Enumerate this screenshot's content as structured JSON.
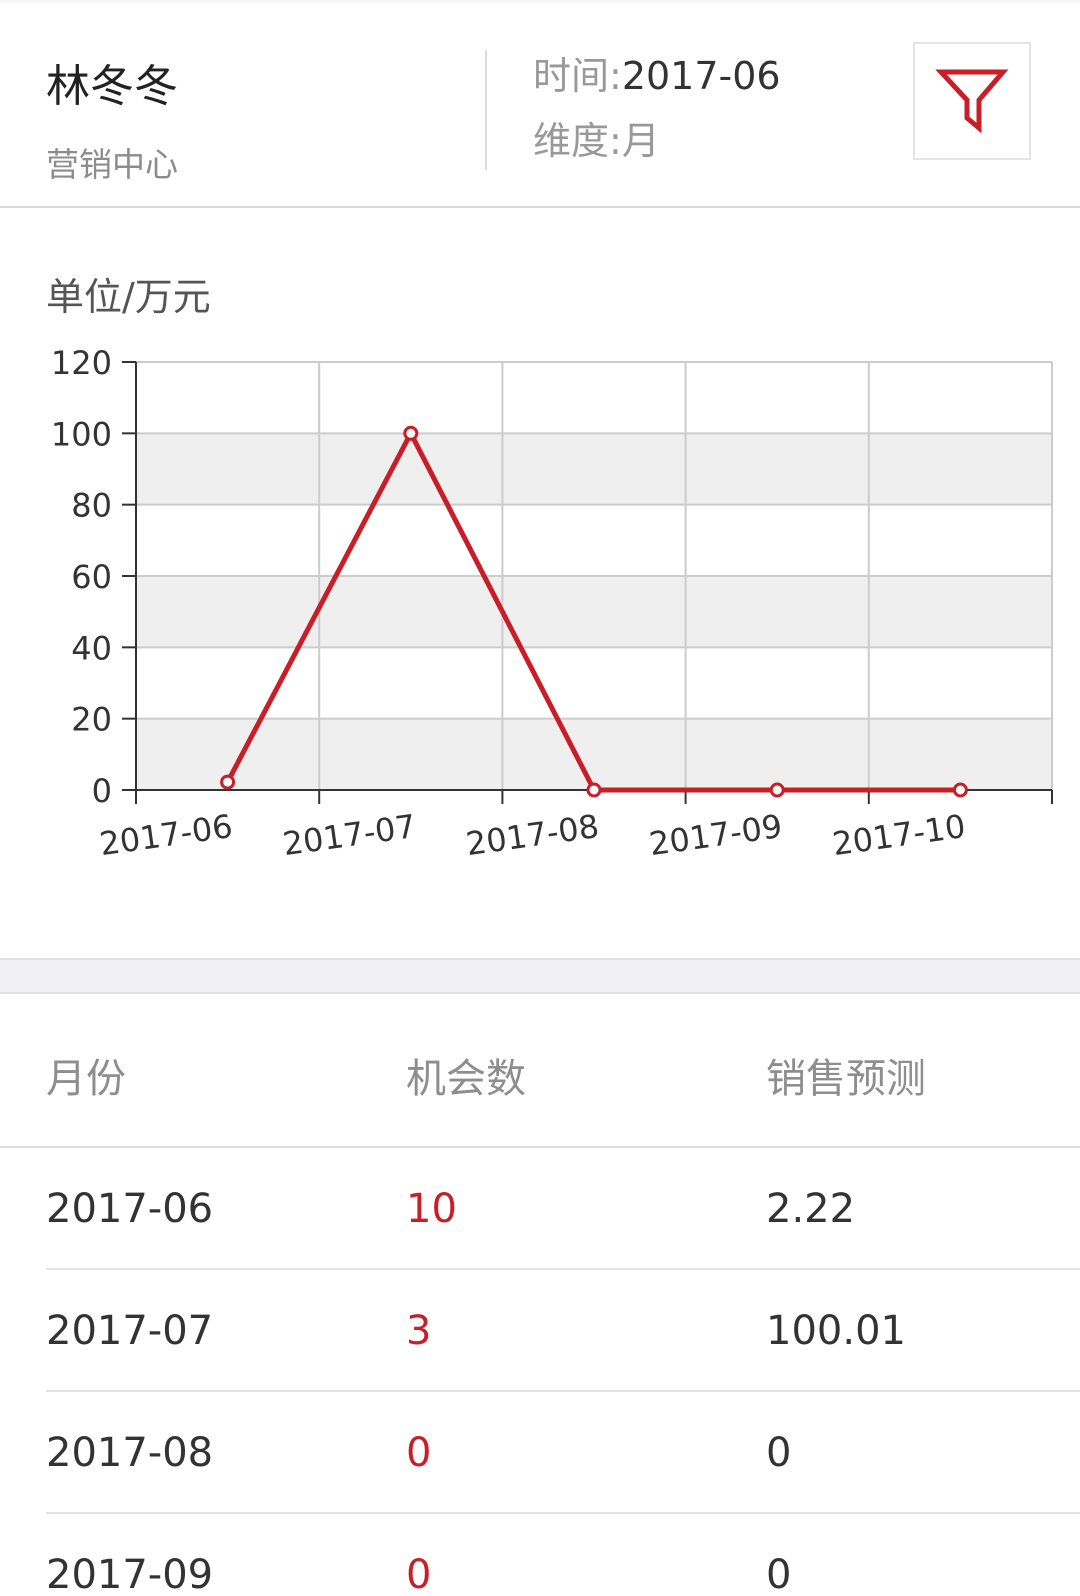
{
  "header": {
    "user_name": "林冬冬",
    "department": "营销中心",
    "time_label": "时间:",
    "time_value": "2017-06",
    "dimension_label": "维度:",
    "dimension_value": "月",
    "filter_icon": "filter-icon"
  },
  "chart": {
    "unit_label": "单位/万元"
  },
  "chart_data": {
    "type": "line",
    "categories": [
      "2017-06",
      "2017-07",
      "2017-08",
      "2017-09",
      "2017-10"
    ],
    "values": [
      2.22,
      100.01,
      0,
      0,
      0
    ],
    "ylim": [
      0,
      120
    ],
    "yticks": [
      0,
      20,
      40,
      60,
      80,
      100,
      120
    ],
    "grid": true,
    "line_color": "#c81e28",
    "band_color": "#efefef"
  },
  "table": {
    "headers": [
      "月份",
      "机会数",
      "销售预测"
    ],
    "rows": [
      [
        "2017-06",
        "10",
        "2.22"
      ],
      [
        "2017-07",
        "3",
        "100.01"
      ],
      [
        "2017-08",
        "0",
        "0"
      ],
      [
        "2017-09",
        "0",
        "0"
      ]
    ]
  },
  "colors": {
    "accent": "#c81e28",
    "secondary_text": "#999999"
  }
}
